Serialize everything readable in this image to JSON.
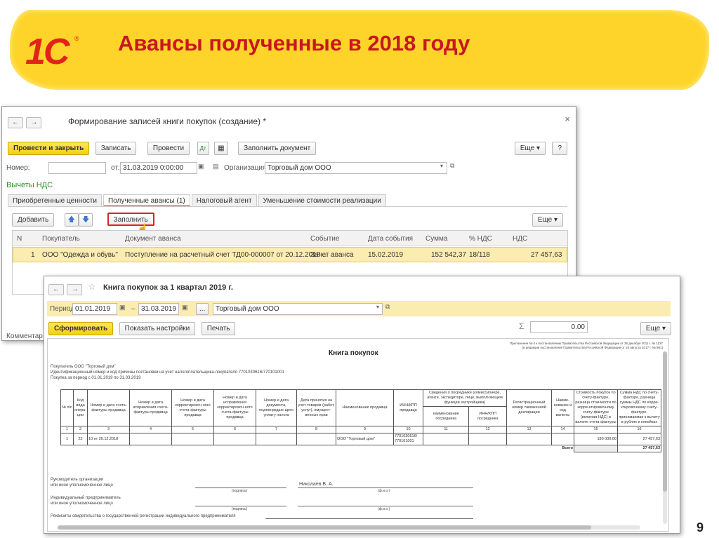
{
  "slide": {
    "logo": "1С",
    "logo_mark": "®",
    "title": "Авансы полученные в 2018 году",
    "page_number": "9"
  },
  "colors": {
    "banner": "#ffd42a",
    "title": "#c8181e",
    "logo": "#e2231a"
  },
  "window1": {
    "title": "Формирование записей книги покупок (создание) *",
    "toolbar": {
      "post_close": "Провести и закрыть",
      "save": "Записать",
      "post": "Провести",
      "fill_doc": "Заполнить документ",
      "more": "Еще",
      "help": "?"
    },
    "number_label": "Номер:",
    "number_value": "",
    "from_label": "от:",
    "date_value": "31.03.2019  0:00:00",
    "org_label": "Организация:",
    "org_value": "Торговый дом ООО",
    "section_title": "Вычеты НДС",
    "tabs": [
      "Приобретенные ценности",
      "Полученные авансы (1)",
      "Налоговый агент",
      "Уменьшение стоимости реализации"
    ],
    "add_button": "Добавить",
    "fill_button": "Заполнить",
    "more_button": "Еще",
    "columns": [
      "N",
      "Покупатель",
      "Документ аванса",
      "Событие",
      "Дата события",
      "Сумма",
      "% НДС",
      "НДС"
    ],
    "rows": [
      {
        "n": "1",
        "buyer": "ООО \"Одежда и обувь\"",
        "document": "Поступление на расчетный счет ТД00-000007 от 20.12.2018 ...",
        "event": "Зачет аванса",
        "date": "15.02.2019",
        "sum": "152 542,37",
        "rate": "18/118",
        "vat": "27 457,63"
      }
    ],
    "comment_label": "Комментар"
  },
  "window2": {
    "title": "Книга покупок за 1 квартал 2019 г.",
    "period_label": "Период:",
    "period_from": "01.01.2019",
    "dash": "–",
    "period_to": "31.03.2019",
    "dots": "...",
    "org_value": "Торговый дом ООО",
    "toolbar": {
      "generate": "Сформировать",
      "show_settings": "Показать настройки",
      "print": "Печать",
      "more": "Еще"
    },
    "sigma": "Σ",
    "sum_value": "0.00",
    "doc": {
      "header_note_1": "Приложение № 4 к постановлению Правительства Российской Федерации от 26 декабря 2011 г. № 1137",
      "header_note_2": "(в редакции постановления Правительства Российской Федерации от 19 августа 2017 г. № 981)",
      "heading": "Книга покупок",
      "buyer_line": "Покупатель  ООО \"Торговый дом\"",
      "inn_line": "Идентификационный номер и код причины постановки на учет налогоплательщика-покупателя  7701030616/770101001",
      "period_line": "Покупка за период с 01.01.2019 по 31.03.2019",
      "col_headers": [
        "№ п/п",
        "Код вида опера-ции",
        "Номер и дата счета-фактуры продавца",
        "Номер и дата исправления счета-фактуры продавца",
        "Номер и дата корректировоч-ного счета-фактуры продавца",
        "Номер и дата исправления корректировоч-ного счета-фактуры продавца",
        "Номер и дата документа, подтверждаю-щего уплату налога",
        "Дата принятия на учет товаров (работ, услуг), имущест-венных прав",
        "Наименование продавца",
        "ИНН/КПП продавца",
        "Сведения о посреднике (комиссионере, агенте, экспедиторе, лице, выполняющем функции застройщика)",
        "Регистрационный номер таможенной декларации",
        "Наиме-нование и код валюты",
        "Стоимость покупок по счету-фактуре, разница стои-мости по корре-ктировочному счету-фактуре (включая НДС) в валюте счета-фактуры",
        "Сумма НДС по счету-фактуре, разница суммы НДС по корре-ктировочному счету-фактуре, принимаемая к вычету в рублях и копейках"
      ],
      "sub_headers": [
        "наименование посредника",
        "ИНН/КПП посредника"
      ],
      "col_numbers": [
        "1",
        "2",
        "3",
        "4",
        "5",
        "6",
        "7",
        "8",
        "9",
        "10",
        "11",
        "12",
        "13",
        "14",
        "15",
        "16"
      ],
      "row": {
        "n": "1",
        "code": "22",
        "invoice": "10 от 20.12.2018",
        "seller": "ООО \"Торговый дом\"",
        "inn": "7701030616/ 770101001",
        "cost": "180 000,00",
        "vat": "27 457,63"
      },
      "total_label": "Всего",
      "total_value": "27 457,63",
      "sign_head_1": "Руководитель организации",
      "sign_head_2": "или иное уполномоченное лицо",
      "sign_name": "Николаев В. А.",
      "sign_caption_1": "(подпись)",
      "sign_caption_2": "(ф.и.о.)",
      "ip_1": "Индивидуальный предприниматель",
      "ip_2": "или иное уполномоченное лицо",
      "requisites": "Реквизиты свидетельства о государственной регистрации индивидуального предпринимателя"
    }
  }
}
